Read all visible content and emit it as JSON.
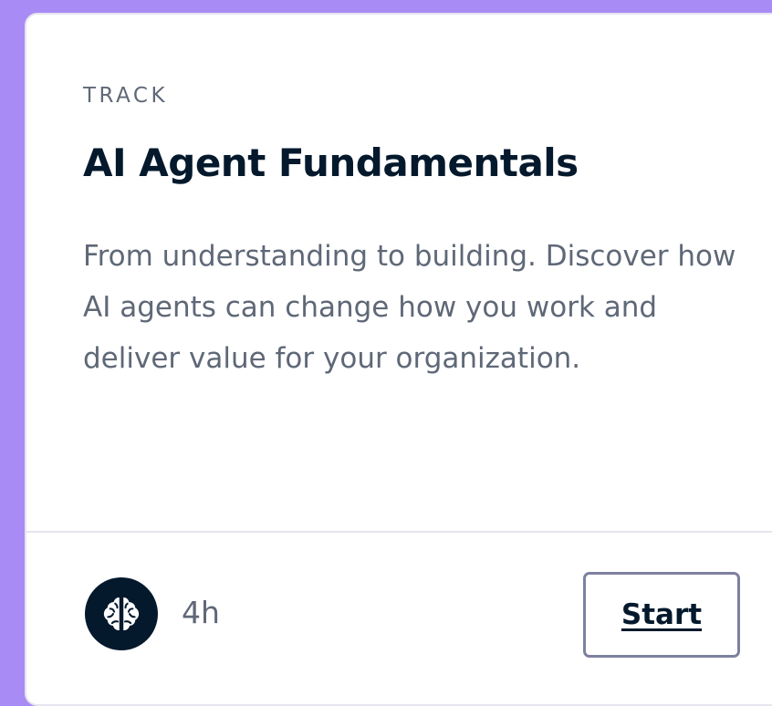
{
  "card": {
    "label": "TRACK",
    "title": "AI Agent Fundamentals",
    "description": "From understanding to building. Discover how AI agents can change how you work and deliver value for your organization.",
    "duration": "4h",
    "start_label": "Start",
    "icon": "brain-icon"
  },
  "colors": {
    "background": "#a98bf5",
    "card": "#ffffff",
    "title": "#05192d",
    "text_muted": "#5f6877",
    "button_border": "#7e80a0"
  }
}
